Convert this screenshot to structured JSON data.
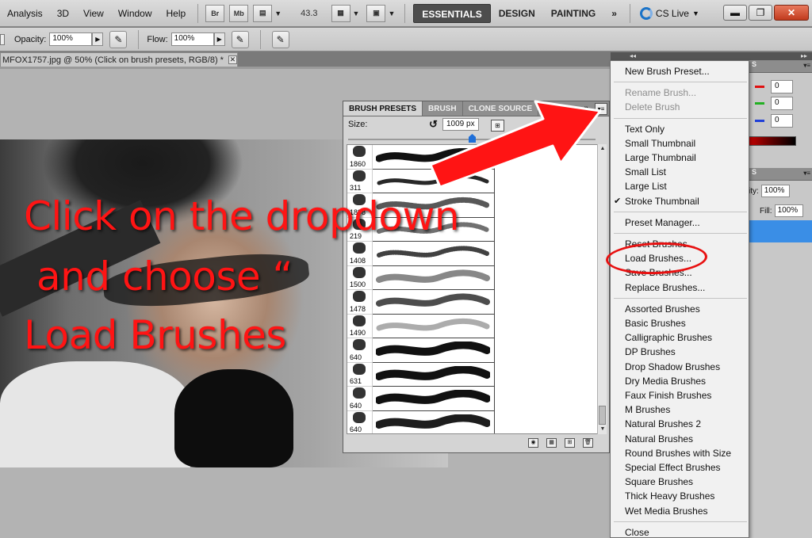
{
  "menubar": {
    "items": [
      "Analysis",
      "3D",
      "View",
      "Window",
      "Help"
    ],
    "bridge": "Br",
    "minibridge": "Mb",
    "zoom": "43.3",
    "workspaces": [
      "ESSENTIALS",
      "DESIGN",
      "PAINTING"
    ],
    "more": "»",
    "cslive": "CS Live"
  },
  "options": {
    "opacity_label": "Opacity:",
    "opacity_value": "100%",
    "flow_label": "Flow:",
    "flow_value": "100%"
  },
  "document": {
    "tab_title": "MFOX1757.jpg @ 50% (Click on brush presets, RGB/8) *"
  },
  "instruction": {
    "line1": "Click on the dropdown",
    "line2": "and choose “",
    "line3": "Load Brushes"
  },
  "brush_panel": {
    "tabs": [
      "BRUSH PRESETS",
      "BRUSH",
      "CLONE SOURCE"
    ],
    "size_label": "Size:",
    "size_value": "1009 px",
    "size_slider_fraction": 0.5,
    "presets": [
      "1860",
      "311",
      "1898",
      "219",
      "1408",
      "1500",
      "1478",
      "1490",
      "640",
      "631",
      "640",
      "640"
    ]
  },
  "color_panel": {
    "r": "0",
    "g": "0",
    "b": "0",
    "colors": {
      "r": "#e01010",
      "g": "#22b022",
      "b": "#1f3fd8"
    }
  },
  "layers_panel": {
    "opacity_label": "ity:",
    "opacity_value": "100%",
    "fill_label": "Fill:",
    "fill_value": "100%"
  },
  "dropdown": {
    "items": [
      "New Brush Preset...",
      "Rename Brush...",
      "Delete Brush",
      "Text Only",
      "Small Thumbnail",
      "Large Thumbnail",
      "Small List",
      "Large List",
      "Stroke Thumbnail",
      "Preset Manager...",
      "Reset Brushes...",
      "Load Brushes...",
      "Save Brushes...",
      "Replace Brushes...",
      "Assorted Brushes",
      "Basic Brushes",
      "Calligraphic Brushes",
      "DP Brushes",
      "Drop Shadow Brushes",
      "Dry Media Brushes",
      "Faux Finish Brushes",
      "M Brushes",
      "Natural Brushes 2",
      "Natural Brushes",
      "Round Brushes with Size",
      "Special Effect Brushes",
      "Square Brushes",
      "Thick Heavy Brushes",
      "Wet Media Brushes",
      "Close"
    ],
    "checked": "Stroke Thumbnail",
    "highlighted": "Load Brushes..."
  },
  "accent": {
    "annotation_red": "#ff1414",
    "selection_blue": "#3a8ee6"
  }
}
